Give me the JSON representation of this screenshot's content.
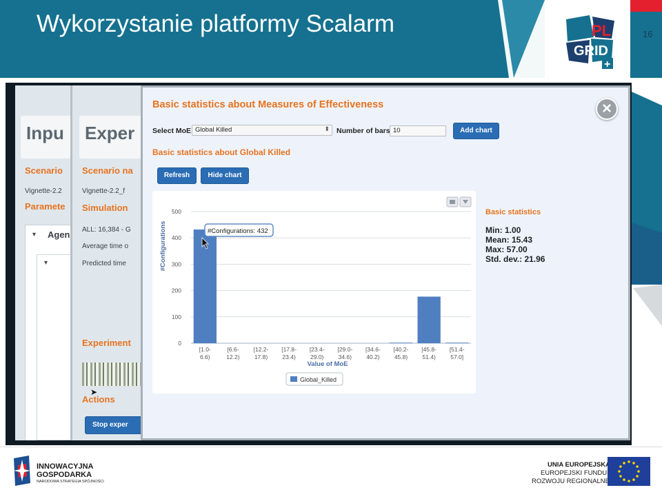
{
  "slide": {
    "title": "Wykorzystanie platformy Scalarm",
    "page_number": "16",
    "logo_text_top": "PL",
    "logo_text_bottom": "GRID",
    "logo_plus": "+"
  },
  "background_app": {
    "panel1_heading": "Inpu",
    "panel1_labels": [
      "Scenario",
      "Paramete"
    ],
    "panel1_texts": [
      "Vignette-2.2",
      "Agen"
    ],
    "panel2_heading": "Exper",
    "panel2_labels": [
      "Scenario na",
      "Simulation",
      "Experiment",
      "Actions"
    ],
    "panel2_texts": [
      "Vignette-2.2_f",
      "ALL: 16,384 - G",
      "Average time o",
      "Predicted time"
    ],
    "stop_button_label": "Stop exper"
  },
  "dialog": {
    "title": "Basic statistics about Measures of Effectiveness",
    "select_moe_label": "Select MoE:",
    "select_moe_value": "Global Killed",
    "number_of_bars_label": "Number of bars:",
    "number_of_bars_value": "10",
    "add_chart_label": "Add chart",
    "subtitle": "Basic statistics about Global Killed",
    "refresh_label": "Refresh",
    "hide_chart_label": "Hide chart",
    "stats": {
      "title": "Basic statistics",
      "min": "Min: 1.00",
      "mean": "Mean: 15.43",
      "max": "Max: 57.00",
      "std": "Std. dev.: 21.96"
    }
  },
  "chart_data": {
    "type": "bar",
    "categories": [
      "[1.0-\n6.6)",
      "[6.6-\n12.2)",
      "[12.2-\n17.8)",
      "[17.8-\n23.4)",
      "[23.4-\n29.0)",
      "[29.0-\n34.6)",
      "[34.6-\n40.2)",
      "[40.2-\n45.8)",
      "[45.8-\n51.4)",
      "[51.4-\n57.0]"
    ],
    "series": [
      {
        "name": "Global_Killed",
        "values": [
          432,
          0,
          0,
          0,
          0,
          0,
          0,
          2,
          177,
          2
        ],
        "color": "#4f7fc1"
      }
    ],
    "xlabel": "Value of MoE",
    "ylabel": "#Configurations",
    "ylim": [
      0,
      500
    ],
    "yticks": [
      0,
      100,
      200,
      300,
      400,
      500
    ],
    "grid": true,
    "legend": "bottom",
    "tooltip": "#Configurations: 432"
  },
  "footer": {
    "left_line1": "INNOWACYJNA",
    "left_line2": "GOSPODARKA",
    "left_line3": "NARODOWA STRATEGIA SPÓJNOŚCI",
    "right_line1": "UNIA EUROPEJSKA",
    "right_line2": "EUROPEJSKI FUNDUSZ",
    "right_line3": "ROZWOJU REGIONALNEGO"
  }
}
